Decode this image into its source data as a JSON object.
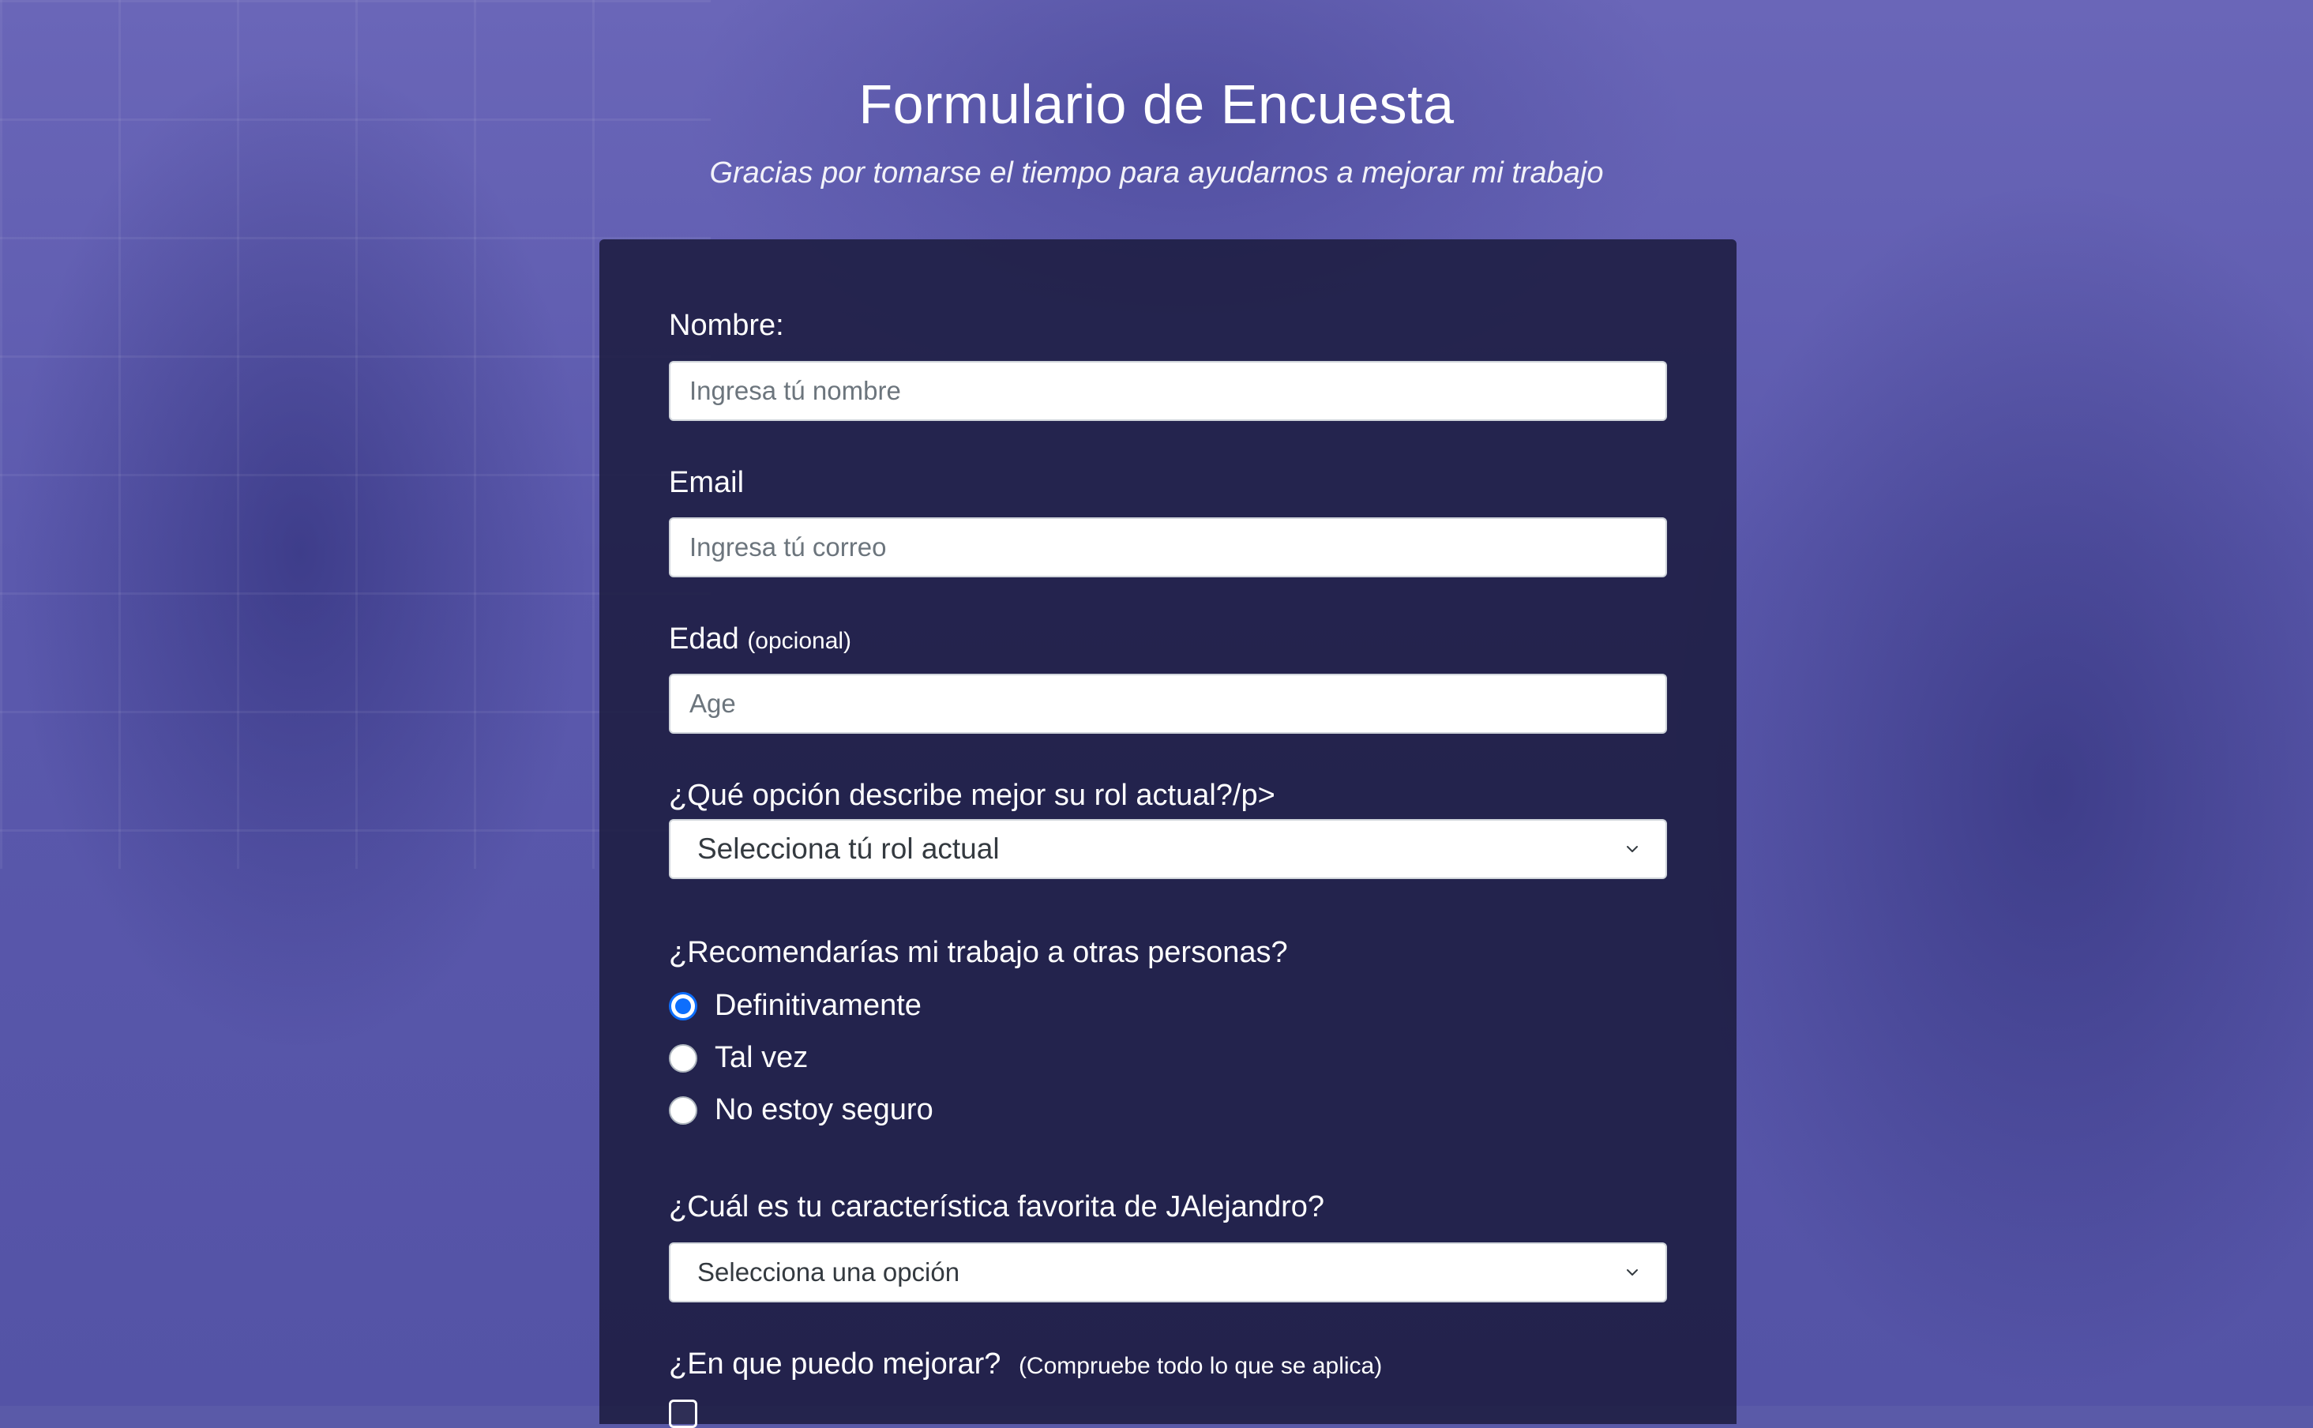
{
  "header": {
    "title": "Formulario de Encuesta",
    "subtitle": "Gracias por tomarse el tiempo para ayudarnos a mejorar mi trabajo"
  },
  "form": {
    "name": {
      "label": "Nombre:",
      "placeholder": "Ingresa tú nombre",
      "value": ""
    },
    "email": {
      "label": "Email",
      "placeholder": "Ingresa tú correo",
      "value": ""
    },
    "age": {
      "label": "Edad",
      "label_note": "(opcional)",
      "placeholder": "Age",
      "value": ""
    },
    "role": {
      "label": "¿Qué opción describe mejor su rol actual?/p>",
      "selected": "Selecciona tú rol actual"
    },
    "recommend": {
      "label": "¿Recomendarías mi trabajo a otras personas?",
      "options": [
        {
          "label": "Definitivamente",
          "checked": true
        },
        {
          "label": "Tal vez",
          "checked": false
        },
        {
          "label": "No estoy seguro",
          "checked": false
        }
      ]
    },
    "favorite": {
      "label": "¿Cuál es tu característica favorita de JAlejandro?",
      "selected": "Selecciona una opción"
    },
    "improve": {
      "label": "¿En que puedo mejorar?",
      "label_note": "(Compruebe todo lo que se aplica)"
    }
  },
  "colors": {
    "background_tint": "#5a5aa8",
    "card": "#1b1b3e",
    "radio_accent": "#0d6efd",
    "text": "#ffffff"
  },
  "icons": {
    "select_arrow": "chevron-down-icon"
  }
}
